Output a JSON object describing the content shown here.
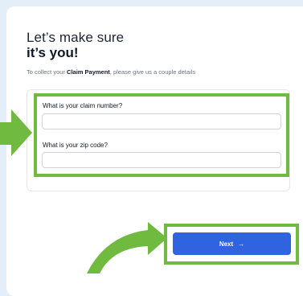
{
  "header": {
    "title_line1": "Let’s make sure",
    "title_line2": "it’s you!"
  },
  "intro": {
    "prefix": "To collect your ",
    "emphasis": "Claim Payment",
    "suffix": ", please give us a couple details"
  },
  "form": {
    "claim_number_label": "What is your claim number?",
    "claim_number_value": "",
    "zip_code_label": "What is your zip code?",
    "zip_code_value": ""
  },
  "actions": {
    "next_label": "Next",
    "next_arrow": "→"
  },
  "colors": {
    "highlight": "#6fba3f",
    "primary": "#2f63e0",
    "background": "#e3eef8"
  },
  "icons": [
    "arrow-right-icon",
    "pointer-arrow-icon"
  ]
}
